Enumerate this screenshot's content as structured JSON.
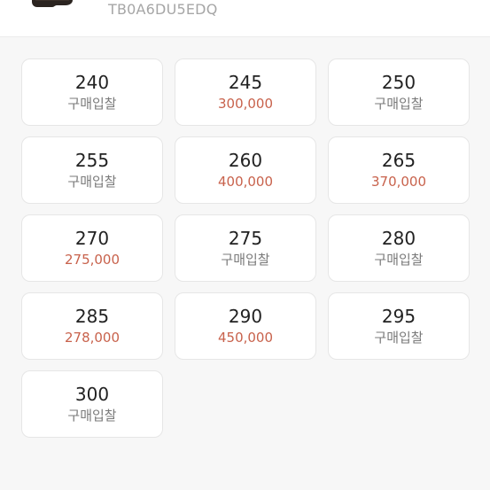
{
  "header": {
    "model_code": "TB0A6DU5EDQ"
  },
  "colors": {
    "price": "#c8624c",
    "bid_text": "#7a7a7a",
    "size_text": "#222222"
  },
  "sizes": [
    {
      "size": "240",
      "sub": "구매입찰",
      "is_price": false
    },
    {
      "size": "245",
      "sub": "300,000",
      "is_price": true
    },
    {
      "size": "250",
      "sub": "구매입찰",
      "is_price": false
    },
    {
      "size": "255",
      "sub": "구매입찰",
      "is_price": false
    },
    {
      "size": "260",
      "sub": "400,000",
      "is_price": true
    },
    {
      "size": "265",
      "sub": "370,000",
      "is_price": true
    },
    {
      "size": "270",
      "sub": "275,000",
      "is_price": true
    },
    {
      "size": "275",
      "sub": "구매입찰",
      "is_price": false
    },
    {
      "size": "280",
      "sub": "구매입찰",
      "is_price": false
    },
    {
      "size": "285",
      "sub": "278,000",
      "is_price": true
    },
    {
      "size": "290",
      "sub": "450,000",
      "is_price": true
    },
    {
      "size": "295",
      "sub": "구매입찰",
      "is_price": false
    },
    {
      "size": "300",
      "sub": "구매입찰",
      "is_price": false
    }
  ]
}
